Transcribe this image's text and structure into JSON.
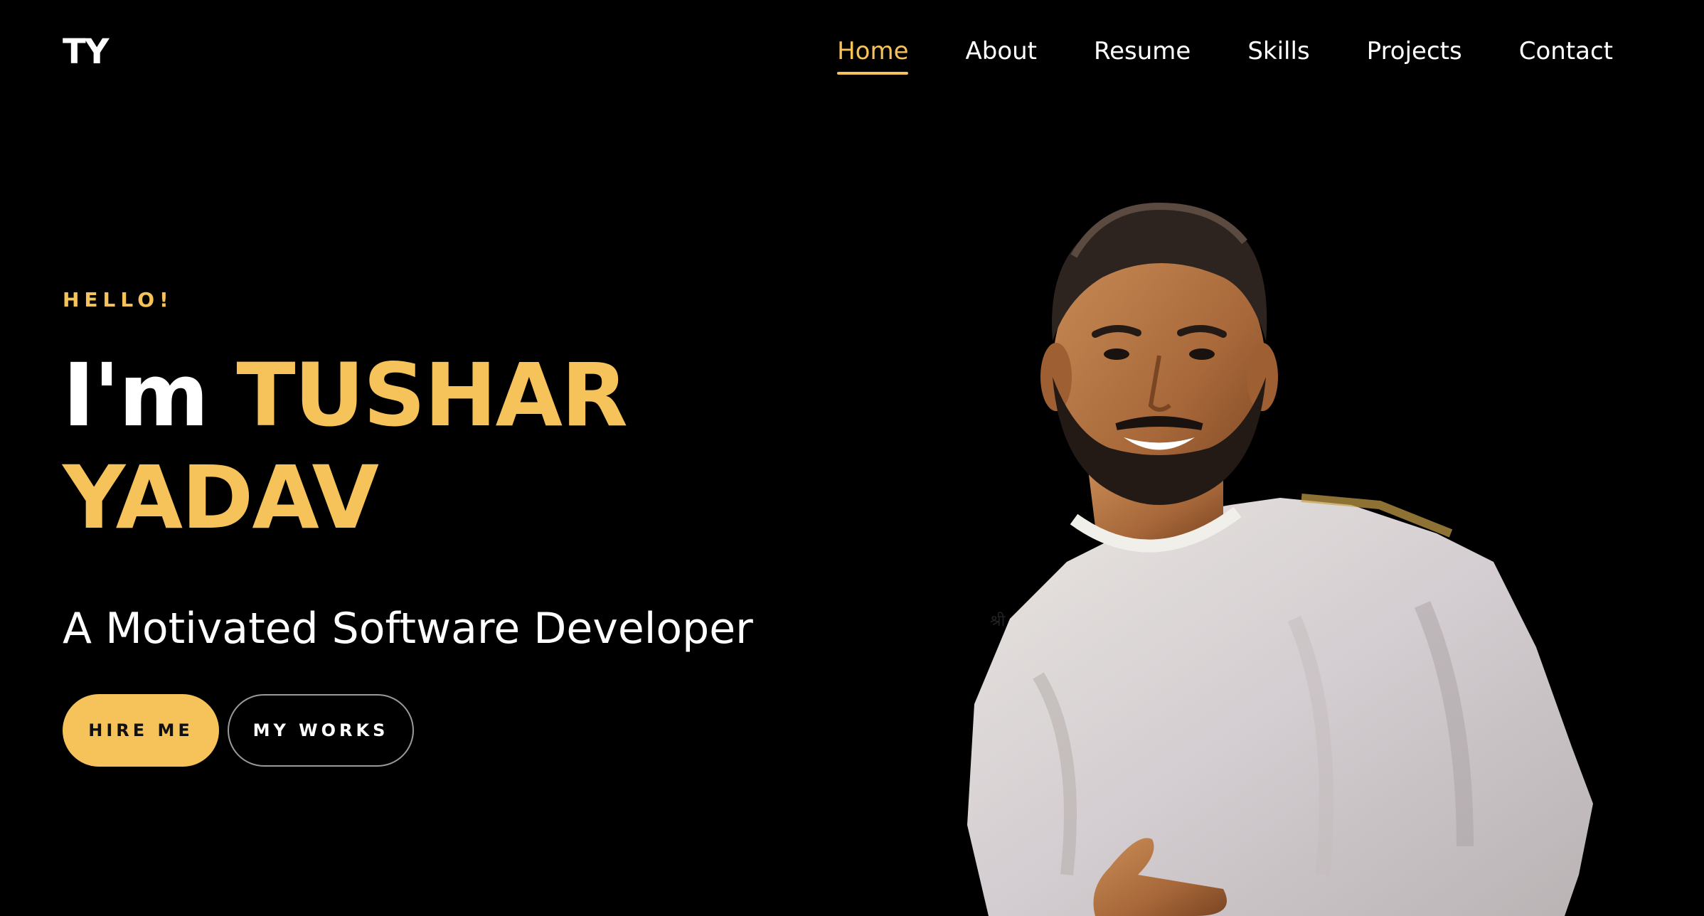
{
  "logo": {
    "text": "TY"
  },
  "nav": {
    "items": [
      {
        "label": "Home",
        "active": true
      },
      {
        "label": "About",
        "active": false
      },
      {
        "label": "Resume",
        "active": false
      },
      {
        "label": "Skills",
        "active": false
      },
      {
        "label": "Projects",
        "active": false
      },
      {
        "label": "Contact",
        "active": false
      }
    ]
  },
  "hero": {
    "greeting": "HELLO!",
    "intro": "I'm",
    "first_name": "TUSHAR",
    "last_name": "YADAV",
    "subtitle": "A Motivated Software Developer",
    "primary_button": "HIRE ME",
    "secondary_button": "MY WORKS"
  },
  "colors": {
    "background": "#000000",
    "accent": "#f6c25a",
    "text": "#ffffff"
  },
  "portrait": {
    "icon": "person-photo",
    "alt": "Portrait photo"
  }
}
